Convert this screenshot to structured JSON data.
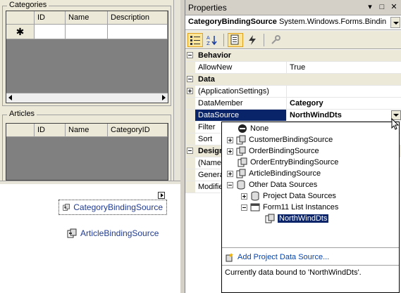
{
  "designer": {
    "categories_group": {
      "title": "Categories",
      "columns": [
        "ID",
        "Name",
        "Description"
      ],
      "new_row_marker": "✱"
    },
    "articles_group": {
      "title": "Articles",
      "columns": [
        "ID",
        "Name",
        "CategoryID"
      ]
    },
    "tray": {
      "components": [
        "CategoryBindingSource",
        "ArticleBindingSource"
      ]
    }
  },
  "properties": {
    "title": "Properties",
    "title_buttons": [
      "▾",
      "□",
      "✕"
    ],
    "object_name": "CategoryBindingSource",
    "object_type": "System.Windows.Forms.Bindin",
    "toolbar": [
      "categorized-icon",
      "alphabetical-icon",
      "properties-icon",
      "events-icon",
      "property-pages-icon"
    ],
    "categories": [
      {
        "name": "Behavior",
        "rows": [
          {
            "name": "AllowNew",
            "value": "True"
          }
        ]
      },
      {
        "name": "Data",
        "rows": [
          {
            "name": "(ApplicationSettings)",
            "value": ""
          },
          {
            "name": "DataMember",
            "value": "Category"
          },
          {
            "name": "DataSource",
            "value": "NorthWindDts"
          },
          {
            "name": "Filter",
            "value": ""
          },
          {
            "name": "Sort",
            "value": ""
          }
        ]
      },
      {
        "name": "Design",
        "rows": [
          {
            "name": "(Name)",
            "value": ""
          },
          {
            "name": "Genera",
            "value": ""
          },
          {
            "name": "Modifie",
            "value": ""
          }
        ]
      }
    ]
  },
  "dropdown": {
    "items": [
      "None",
      "CustomerBindingSource",
      "OrderBindingSource",
      "OrderEntryBindingSource",
      "ArticleBindingSource",
      "Other Data Sources",
      "Project Data Sources",
      "Form11 List Instances",
      "NorthWindDts"
    ],
    "add_link": "Add Project Data Source...",
    "status": "Currently data bound to 'NorthWindDts'."
  },
  "colors": {
    "selection": "#0a246a",
    "link": "#0645ad",
    "component_text": "#1f3a93"
  }
}
